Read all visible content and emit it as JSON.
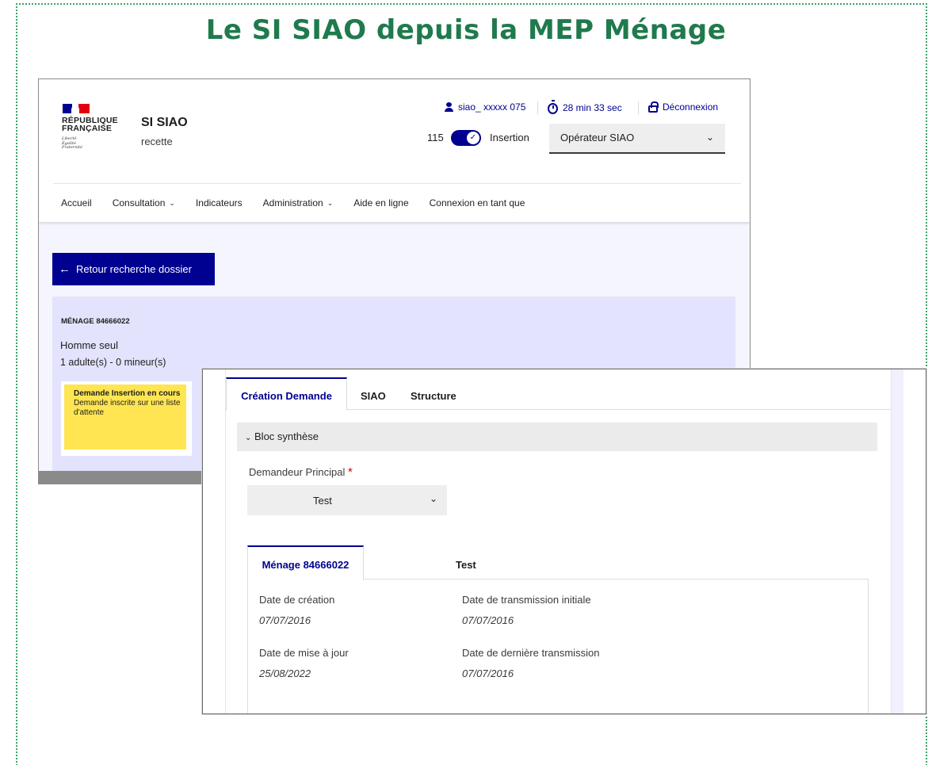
{
  "slide": {
    "title": "Le SI SIAO depuis la MEP Ménage"
  },
  "header": {
    "republique": [
      "RÉPUBLIQUE",
      "FRANÇAISE"
    ],
    "motto": [
      "Liberté",
      "Égalité",
      "Fraternité"
    ],
    "app_name": "SI SIAO",
    "app_env": "recette",
    "user": "siao_ xxxxx 075",
    "timer": "28 min 33 sec",
    "logout": "Déconnexion",
    "toggle_left": "115",
    "toggle_right": "Insertion",
    "role_select": "Opérateur SIAO"
  },
  "nav": {
    "items": [
      {
        "label": "Accueil",
        "dropdown": false
      },
      {
        "label": "Consultation",
        "dropdown": true
      },
      {
        "label": "Indicateurs",
        "dropdown": false
      },
      {
        "label": "Administration",
        "dropdown": true
      },
      {
        "label": "Aide en ligne",
        "dropdown": false
      },
      {
        "label": "Connexion en tant que",
        "dropdown": false
      }
    ]
  },
  "main": {
    "back_button": "Retour recherche dossier",
    "menage_id": "MÉNAGE 84666022",
    "menage_type": "Homme seul",
    "menage_count": "1 adulte(s) - 0 mineur(s)",
    "badge_title": "Demande Insertion en cours",
    "badge_text": "Demande inscrite sur une liste d'attente"
  },
  "detail": {
    "tabs": [
      "Création Demande",
      "SIAO",
      "Structure"
    ],
    "accordion": "Bloc synthèse",
    "demandeur_label": "Demandeur Principal",
    "demandeur_required": "*",
    "demandeur_value": "Test",
    "inner_tabs": [
      "Ménage 84666022",
      "Test"
    ],
    "fields": {
      "date_creation_label": "Date de création",
      "date_creation_value": "07/07/2016",
      "date_transmission_initiale_label": "Date de transmission initiale",
      "date_transmission_initiale_value": "07/07/2016",
      "date_maj_label": "Date de mise à jour",
      "date_maj_value": "25/08/2022",
      "date_derniere_transmission_label": "Date de dernière transmission",
      "date_derniere_transmission_value": "07/07/2016"
    }
  },
  "colors": {
    "title_green": "#1f7a4d",
    "primary_blue": "#000091",
    "badge_yellow": "#ffe552",
    "panel_lavender": "#e3e3fd"
  }
}
